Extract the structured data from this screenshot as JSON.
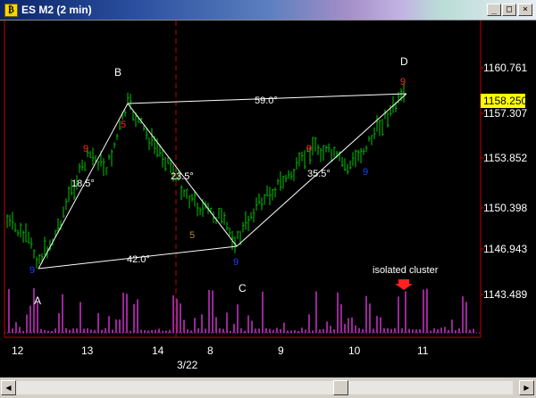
{
  "window": {
    "title": "ES M2 (2 min)",
    "app_icon_glyph": "₿",
    "minimize_glyph": "_",
    "maximize_glyph": "□",
    "close_glyph": "×"
  },
  "colors": {
    "background": "#000000",
    "bar": "#00c800",
    "volume": "#cc33cc",
    "axis": "#c00000",
    "trendline": "#ffffff",
    "label_red": "#ff2a2a",
    "label_blue": "#2040ff",
    "label_olive": "#b08a2e",
    "price_box": "#ffff00"
  },
  "chart": {
    "price_labels": [
      "1160.761",
      "1157.307",
      "1153.852",
      "1150.398",
      "1146.943",
      "1143.489"
    ],
    "current_price": "1158.250",
    "time_labels": [
      "12",
      "13",
      "14",
      "8",
      "9",
      "10",
      "11"
    ],
    "date_label": "3/22",
    "point_labels": {
      "a": "A",
      "b": "B",
      "c": "C",
      "d": "D"
    },
    "angle_labels": [
      "18.5°",
      "59.0°",
      "23.5°",
      "42.0°",
      "35.5°"
    ],
    "count_labels": {
      "red_9_left": "9",
      "red_5": "5",
      "blue_9_left": "9",
      "olive_5": "5",
      "blue_9_mid": "9",
      "red_9_right": "9",
      "blue_9_right": "9",
      "red_9_top": "9"
    },
    "annotation": "isolated cluster"
  }
}
